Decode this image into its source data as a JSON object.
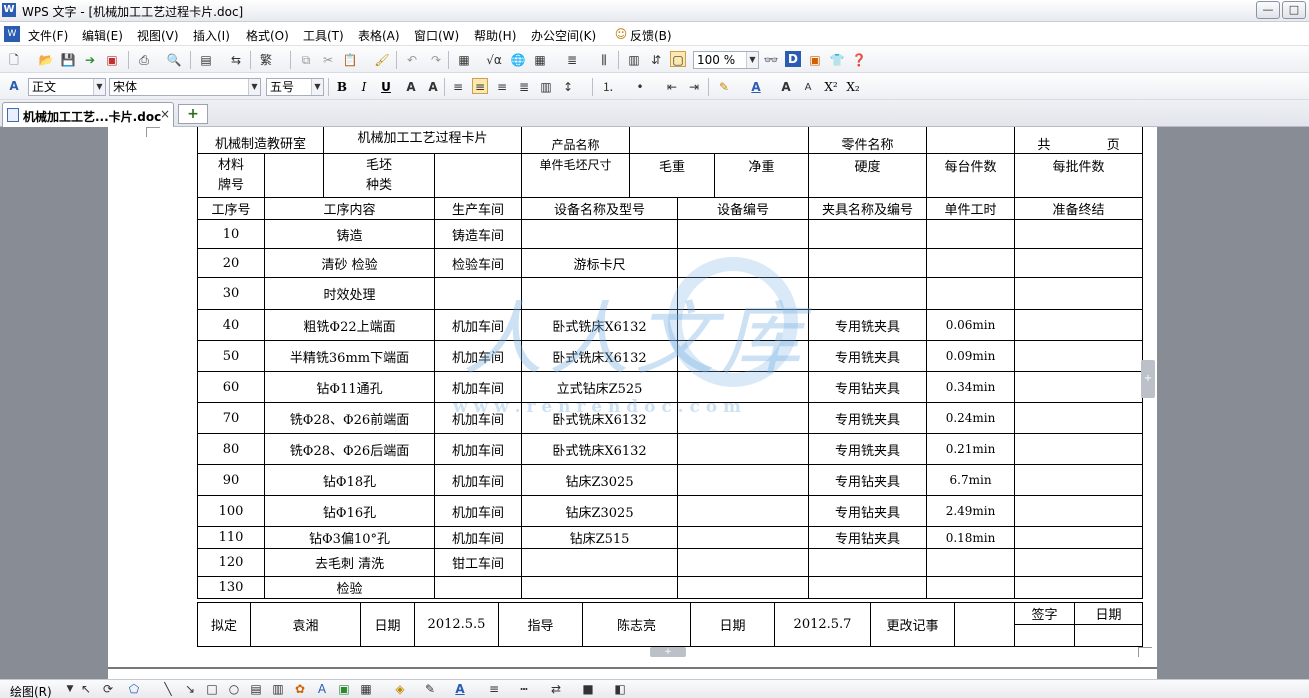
{
  "window": {
    "title": "WPS 文字 - [机械加工工艺过程卡片.doc]",
    "app_icon": "W",
    "buttons": [
      "—",
      "□",
      "✕"
    ]
  },
  "menu": [
    "文件(F)",
    "编辑(E)",
    "视图(V)",
    "插入(I)",
    "格式(O)",
    "工具(T)",
    "表格(A)",
    "窗口(W)",
    "帮助(H)",
    "办公空间(K)",
    "反馈(B)"
  ],
  "toolbar": {
    "zoom": "100 %"
  },
  "format_bar": {
    "style": "正文",
    "font": "宋体",
    "size": "五号",
    "bold": "B",
    "italic": "I",
    "underline": "U",
    "superscript": "X²",
    "subscript": "X₂"
  },
  "tabs": {
    "active": "机械加工工艺...卡片.doc",
    "close": "×",
    "new": "+"
  },
  "card": {
    "dept": "机械制造教研室",
    "title": "机械加工工艺过程卡片",
    "product_name": "产品名称",
    "part_name": "零件名称",
    "total": "共",
    "page": "页",
    "material_no": "材料牌号",
    "blank_type": "毛坯种类",
    "blank_size": "单件毛坯尺寸",
    "gross_weight": "毛重",
    "net_weight": "净重",
    "hardness": "硬度",
    "per_unit": "每台件数",
    "per_batch": "每批件数",
    "headers": [
      "工序号",
      "工序内容",
      "生产车间",
      "设备名称及型号",
      "设备编号",
      "夹具名称及编号",
      "单件工时",
      "准备终结"
    ],
    "rows": [
      {
        "no": "10",
        "content": "铸造",
        "shop": "铸造车间",
        "equip": "",
        "fixture": "",
        "time": ""
      },
      {
        "no": "20",
        "content": "清砂 检验",
        "shop": "检验车间",
        "equip": "游标卡尺",
        "fixture": "",
        "time": ""
      },
      {
        "no": "30",
        "content": "时效处理",
        "shop": "",
        "equip": "",
        "fixture": "",
        "time": ""
      },
      {
        "no": "40",
        "content": "粗铣Φ22上端面",
        "shop": "机加车间",
        "equip": "卧式铣床X6132",
        "fixture": "专用铣夹具",
        "time": "0.06min"
      },
      {
        "no": "50",
        "content": "半精铣36mm下端面",
        "shop": "机加车间",
        "equip": "卧式铣床X6132",
        "fixture": "专用铣夹具",
        "time": "0.09min"
      },
      {
        "no": "60",
        "content": "钻Φ11通孔",
        "shop": "机加车间",
        "equip": "立式钻床Z525",
        "fixture": "专用钻夹具",
        "time": "0.34min"
      },
      {
        "no": "70",
        "content": "铣Φ28、Φ26前端面",
        "shop": "机加车间",
        "equip": "卧式铣床X6132",
        "fixture": "专用铣夹具",
        "time": "0.24min"
      },
      {
        "no": "80",
        "content": "铣Φ28、Φ26后端面",
        "shop": "机加车间",
        "equip": "卧式铣床X6132",
        "fixture": "专用铣夹具",
        "time": "0.21min"
      },
      {
        "no": "90",
        "content": "钻Φ18孔",
        "shop": "机加车间",
        "equip": "钻床Z3025",
        "fixture": "专用钻夹具",
        "time": "6.7min"
      },
      {
        "no": "100",
        "content": "钻Φ16孔",
        "shop": "机加车间",
        "equip": "钻床Z3025",
        "fixture": "专用钻夹具",
        "time": "2.49min"
      },
      {
        "no": "110",
        "content": "钻Φ3偏10°孔",
        "shop": "机加车间",
        "equip": "钻床Z515",
        "fixture": "专用钻夹具",
        "time": "0.18min"
      },
      {
        "no": "120",
        "content": "去毛刺 清洗",
        "shop": "钳工车间",
        "equip": "",
        "fixture": "",
        "time": ""
      },
      {
        "no": "130",
        "content": "检验",
        "shop": "",
        "equip": "",
        "fixture": "",
        "time": ""
      }
    ],
    "footer": {
      "drafted": "拟定",
      "drafter": "袁湘",
      "date_label": "日期",
      "date1": "2012.5.5",
      "guide": "指导",
      "guide_name": "陈志亮",
      "date2": "2012.5.7",
      "change": "更改记事",
      "sign": "签字",
      "date3": "日期"
    }
  },
  "watermark": {
    "text": "人人文库",
    "url": "w w w . r e n r e n d o c . c o m"
  },
  "drawbar": {
    "label": "绘图(R)"
  }
}
